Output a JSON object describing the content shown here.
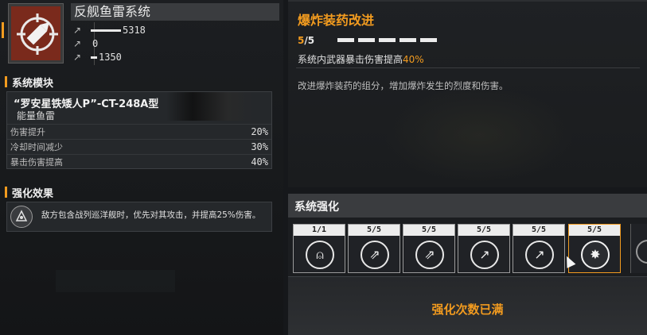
{
  "system": {
    "title": "反舰鱼雷系统",
    "icon": "torpedo-shell-icon",
    "stats": [
      {
        "icon": "damage-icon",
        "value": "5318",
        "fill": 0.7
      },
      {
        "icon": "reload-icon",
        "value": "0",
        "fill": 0
      },
      {
        "icon": "range-icon",
        "value": "1350",
        "fill": 0.2
      }
    ]
  },
  "module_section": {
    "title": "系统模块",
    "module_name": "“罗安星铁矮人P”-CT-248A型",
    "module_type": "能量鱼雷",
    "rows": [
      {
        "label": "伤害提升",
        "value": "20%"
      },
      {
        "label": "冷却时间减少",
        "value": "30%"
      },
      {
        "label": "暴击伤害提高",
        "value": "40%"
      }
    ]
  },
  "effect_section": {
    "title": "强化效果",
    "icon": "fleet-emblem-icon",
    "text": "敌方包含战列巡洋舰时，优先对其攻击，并提高25%伤害。"
  },
  "detail": {
    "title": "爆炸装药改进",
    "level_current": "5",
    "level_total": "/5",
    "pips_filled": 5,
    "effect_prefix": "系统内武器暴击伤害提高",
    "effect_value": "40%",
    "description": "改进爆炸装药的组分，增加爆炸发生的烈度和伤害。"
  },
  "upgrades": {
    "title": "系统强化",
    "cards": [
      {
        "level": "1/1",
        "icon": "bell-plus-icon",
        "selected": false
      },
      {
        "level": "5/5",
        "icon": "missiles-up-icon",
        "selected": false
      },
      {
        "level": "5/5",
        "icon": "missiles-up-icon",
        "selected": false
      },
      {
        "level": "5/5",
        "icon": "torpedo-up-icon",
        "selected": false
      },
      {
        "level": "5/5",
        "icon": "torpedo-up-icon",
        "selected": false
      },
      {
        "level": "5/5",
        "icon": "explosion-icon",
        "selected": true
      }
    ],
    "status": "强化次数已满"
  },
  "colors": {
    "accent": "#f29b1f",
    "icon_bg": "#7a2a1c"
  }
}
